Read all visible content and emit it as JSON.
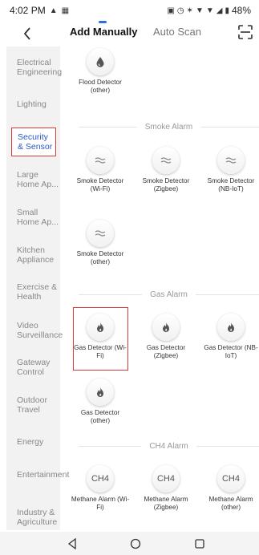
{
  "status_bar": {
    "time": "4:02 PM",
    "battery": "48%"
  },
  "header": {
    "tabs": [
      {
        "label": "Add Manually",
        "active": true
      },
      {
        "label": "Auto Scan",
        "active": false
      }
    ],
    "accent_color": "#2b6ee8"
  },
  "sidebar": {
    "items": [
      {
        "label": "Electrical Engineering",
        "active": false
      },
      {
        "label": "Lighting",
        "active": false
      },
      {
        "label": "Security & Sensor",
        "active": true
      },
      {
        "label": "Large Home Ap...",
        "active": false
      },
      {
        "label": "Small Home Ap...",
        "active": false
      },
      {
        "label": "Kitchen Appliance",
        "active": false
      },
      {
        "label": "Exercise & Health",
        "active": false
      },
      {
        "label": "Video Surveillance",
        "active": false
      },
      {
        "label": "Gateway Control",
        "active": false
      },
      {
        "label": "Outdoor Travel",
        "active": false
      },
      {
        "label": "Energy",
        "active": false
      },
      {
        "label": "Entertainment",
        "active": false
      },
      {
        "label": "Industry & Agriculture",
        "active": false
      }
    ]
  },
  "content": {
    "flood": {
      "name": "Flood Detector (other)",
      "icon": "water-drop-icon"
    },
    "sections": {
      "smoke": "Smoke Alarm",
      "gas": "Gas Alarm",
      "ch4": "CH4 Alarm"
    },
    "smoke_devices": [
      {
        "name": "Smoke Detector (Wi-Fi)",
        "icon": "smoke-icon"
      },
      {
        "name": "Smoke Detector (Zigbee)",
        "icon": "smoke-icon"
      },
      {
        "name": "Smoke Detector (NB-IoT)",
        "icon": "smoke-icon"
      },
      {
        "name": "Smoke Detector (other)",
        "icon": "smoke-icon"
      }
    ],
    "gas_devices": [
      {
        "name": "Gas Detector (Wi-Fi)",
        "icon": "flame-icon",
        "highlighted": true
      },
      {
        "name": "Gas Detector (Zigbee)",
        "icon": "flame-icon"
      },
      {
        "name": "Gas Detector (NB-IoT)",
        "icon": "flame-icon"
      },
      {
        "name": "Gas Detector (other)",
        "icon": "flame-icon"
      }
    ],
    "ch4_devices": [
      {
        "name": "Methane Alarm (Wi-Fi)",
        "icon": "CH4"
      },
      {
        "name": "Methane Alarm (Zigbee)",
        "icon": "CH4"
      },
      {
        "name": "Methane Alarm (other)",
        "icon": "CH4"
      }
    ],
    "highlight_color": "#d63a3a"
  }
}
